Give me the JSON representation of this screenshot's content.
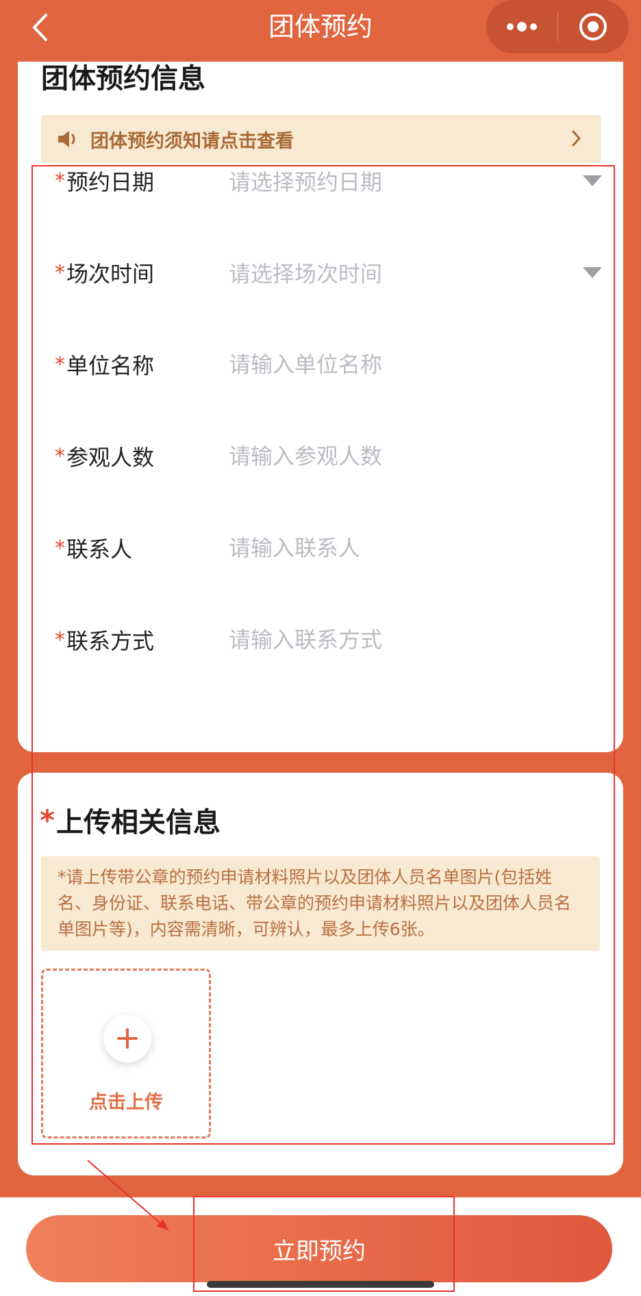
{
  "nav": {
    "title": "团体预约"
  },
  "info_section": {
    "title": "团体预约信息",
    "notice": "团体预约须知请点击查看",
    "fields": [
      {
        "label": "预约日期",
        "placeholder": "请选择预约日期",
        "kind": "select"
      },
      {
        "label": "场次时间",
        "placeholder": "请选择场次时间",
        "kind": "select"
      },
      {
        "label": "单位名称",
        "placeholder": "请输入单位名称",
        "kind": "input"
      },
      {
        "label": "参观人数",
        "placeholder": "请输入参观人数",
        "kind": "input"
      },
      {
        "label": "联系人",
        "placeholder": "请输入联系人",
        "kind": "input"
      },
      {
        "label": "联系方式",
        "placeholder": "请输入联系方式",
        "kind": "input"
      }
    ],
    "required_mark": "*"
  },
  "upload_section": {
    "title": "上传相关信息",
    "required_mark": "*",
    "hint": "*请上传带公章的预约申请材料照片以及团体人员名单图片(包括姓名、身份证、联系电话、带公章的预约申请材料照片以及团体人员名单图片等)，内容需清晰，可辨认，最多上传6张。",
    "upload_label": "点击上传"
  },
  "submit_label": "立即预约",
  "colors": {
    "theme": "#e0653f",
    "required": "#e3462f",
    "notice_bg": "#f8e9d2",
    "annotation": "#ec2f2f"
  }
}
